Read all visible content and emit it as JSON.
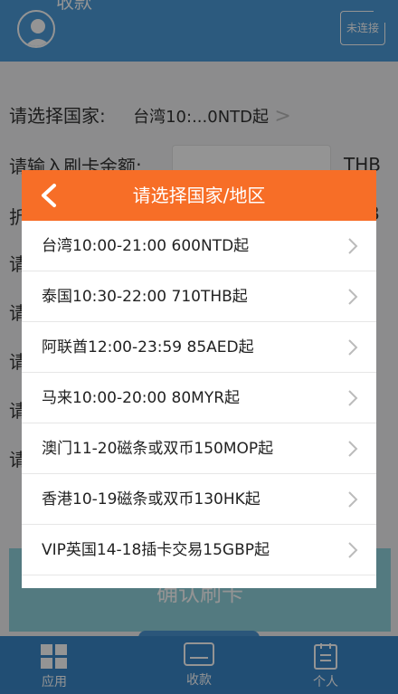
{
  "header": {
    "title": "收款",
    "connection_status": "未连接"
  },
  "form": {
    "country_label": "请选择国家:",
    "country_value": "台湾10:...0NTD起",
    "amount_label": "请输入刷卡金额:",
    "amount_unit": "THB",
    "row3_label": "折",
    "row3_unit": "B",
    "row4_label": "请",
    "row5_label": "请",
    "row6_label": "请",
    "row7_label": "请",
    "row8_label": "请",
    "confirm_label": "确认刷卡"
  },
  "modal": {
    "title": "请选择国家/地区",
    "items": [
      {
        "label": "台湾10:00-21:00   600NTD起"
      },
      {
        "label": "泰国10:30-22:00   710THB起"
      },
      {
        "label": "阿联酋12:00-23:59   85AED起"
      },
      {
        "label": "马来10:00-20:00   80MYR起"
      },
      {
        "label": "澳门11-20磁条或双币150MOP起"
      },
      {
        "label": "香港10-19磁条或双币130HK起"
      },
      {
        "label": "VIP英国14-18插卡交易15GBP起"
      }
    ]
  },
  "tabbar": {
    "items": [
      {
        "label": "应用",
        "icon": "apps-grid-icon"
      },
      {
        "label": "收款",
        "icon": "receipt-icon"
      },
      {
        "label": "个人",
        "icon": "profile-clipboard-icon"
      }
    ]
  },
  "colors": {
    "header_blue": "#4c9bd9",
    "modal_orange": "#f76e27",
    "confirm_teal": "#8fd2dc",
    "tabbar_blue": "#3a87c9"
  }
}
